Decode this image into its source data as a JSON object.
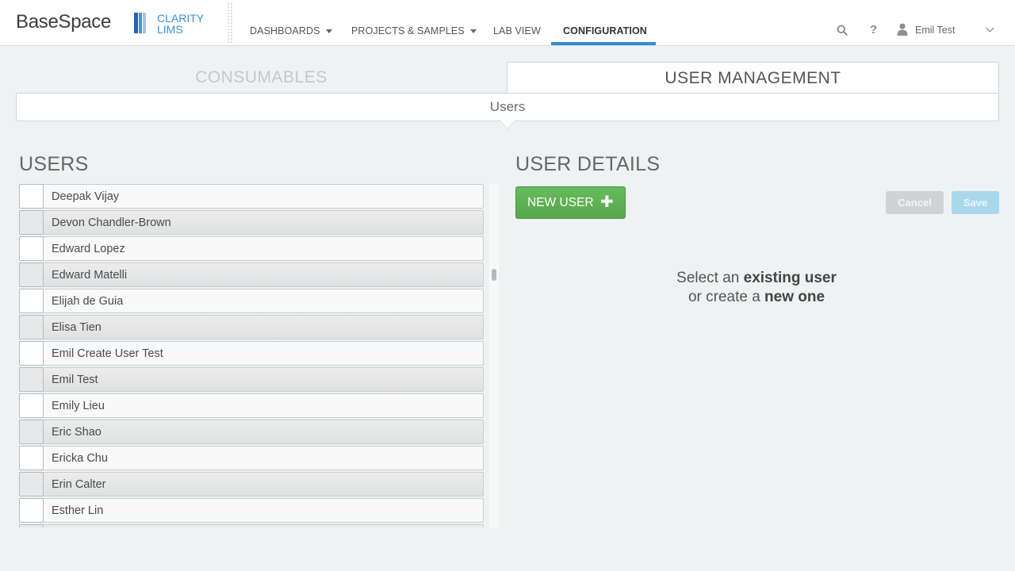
{
  "brand": {
    "product": "BaseSpace",
    "clarity_line1": "CLARITY",
    "clarity_line2": "LIMS"
  },
  "nav": {
    "items": [
      {
        "label": "DASHBOARDS",
        "dropdown": true
      },
      {
        "label": "PROJECTS & SAMPLES",
        "dropdown": true
      },
      {
        "label": "LAB VIEW",
        "dropdown": false
      },
      {
        "label": "CONFIGURATION",
        "dropdown": false,
        "active": true
      }
    ],
    "search_icon": "search-icon",
    "help_label": "?",
    "user_icon": "user-icon",
    "user_name": "Emil Test",
    "accent_color": "#2f8ed6"
  },
  "tabs": {
    "consumables": "CONSUMABLES",
    "user_management": "USER MANAGEMENT",
    "subtab": "Users"
  },
  "users_panel": {
    "title": "USERS",
    "users": [
      "Deepak Vijay",
      "Devon Chandler-Brown",
      "Edward Lopez",
      "Edward Matelli",
      "Elijah de Guia",
      "Elisa Tien",
      "Emil Create User Test",
      "Emil Test",
      "Emily Lieu",
      "Eric Shao",
      "Ericka Chu",
      "Erin Calter",
      "Esther Lin",
      ""
    ]
  },
  "details_panel": {
    "title": "USER DETAILS",
    "new_user_label": "NEW USER",
    "new_user_color": "#5cb050",
    "cancel_label": "Cancel",
    "save_label": "Save",
    "empty_prefix_1": "Select an ",
    "empty_bold_1": "existing user",
    "empty_prefix_2": "or create a ",
    "empty_bold_2": "new one"
  }
}
